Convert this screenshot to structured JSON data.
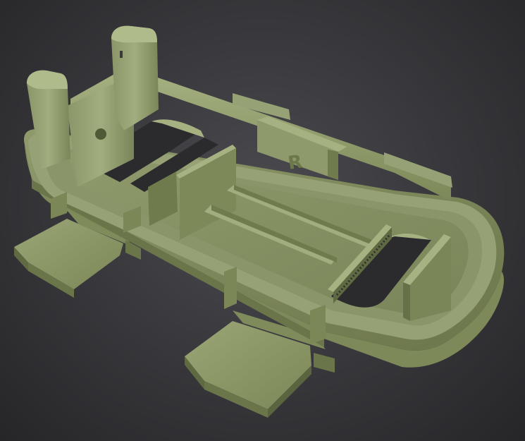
{
  "scene": {
    "subject": "3d-printed-tray-model",
    "background_color": "#3a3a3e",
    "model_color": "#8c9a6a",
    "model_shadow_color": "#5f6b45",
    "model_highlight_color": "#a9b585"
  },
  "embossed_text": {
    "letter": "R"
  }
}
